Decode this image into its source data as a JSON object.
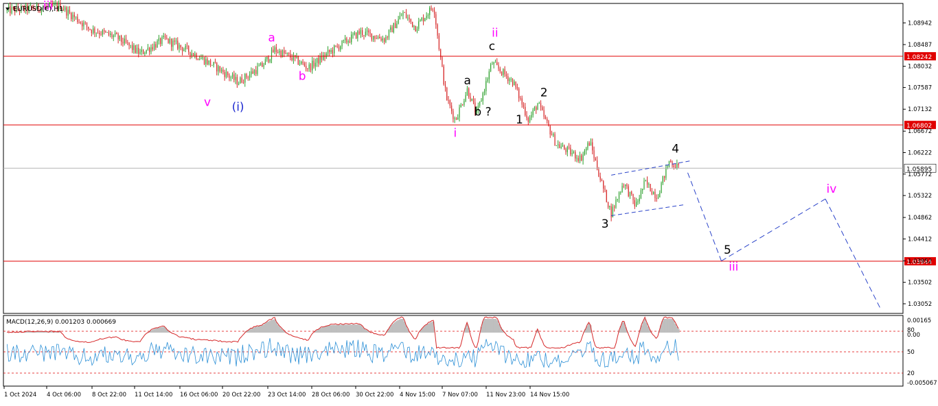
{
  "header": {
    "symbol_label": "EURUSD(€),H1"
  },
  "colors": {
    "bull_candle": "#2ca02c",
    "bear_candle": "#d62728",
    "level_line": "#e00000",
    "current_price": "#b4b4b4",
    "projection": "#2a43c9",
    "label_magenta": "#ff00ff",
    "label_blue": "#1f2bd1",
    "label_black": "#000000",
    "macd_histogram": "#bfbfbf",
    "macd_line": "#d62728",
    "stoch_line": "#2b8fd6"
  },
  "chart_data": {
    "type": "candlestick",
    "symbol": "EURUSD(€)",
    "timeframe": "H1",
    "ylim": [
      1.0285,
      1.0935
    ],
    "y_ticks": [
      "1.08942",
      "1.08487",
      "1.08032",
      "1.07587",
      "1.07132",
      "1.06672",
      "1.06222",
      "1.05772",
      "1.05322",
      "1.04862",
      "1.04412",
      "1.03952",
      "1.03502",
      "1.03052"
    ],
    "x_ticks": [
      "1 Oct 2024",
      "4 Oct 06:00",
      "8 Oct 22:00",
      "11 Oct 14:00",
      "16 Oct 06:00",
      "20 Oct 22:00",
      "23 Oct 14:00",
      "28 Oct 06:00",
      "30 Oct 22:00",
      "4 Nov 15:00",
      "7 Nov 07:00",
      "11 Nov 23:00",
      "14 Nov 15:00"
    ],
    "price_path": [
      {
        "t": 0,
        "price": 1.092
      },
      {
        "t": 0.9,
        "price": 1.093
      },
      {
        "t": 1.0,
        "price": 1.0918
      },
      {
        "t": 1.4,
        "price": 1.088
      },
      {
        "t": 1.8,
        "price": 1.0865
      },
      {
        "t": 2.2,
        "price": 1.083
      },
      {
        "t": 2.6,
        "price": 1.086
      },
      {
        "t": 3.0,
        "price": 1.0835
      },
      {
        "t": 3.4,
        "price": 1.0805
      },
      {
        "t": 3.8,
        "price": 1.077
      },
      {
        "t": 4.2,
        "price": 1.0805
      },
      {
        "t": 4.4,
        "price": 1.0838
      },
      {
        "t": 4.7,
        "price": 1.082
      },
      {
        "t": 4.95,
        "price": 1.08
      },
      {
        "t": 5.3,
        "price": 1.0833
      },
      {
        "t": 5.8,
        "price": 1.0875
      },
      {
        "t": 6.2,
        "price": 1.086
      },
      {
        "t": 6.5,
        "price": 1.0915
      },
      {
        "t": 6.7,
        "price": 1.0885
      },
      {
        "t": 7.0,
        "price": 1.093
      },
      {
        "t": 7.1,
        "price": 1.083
      },
      {
        "t": 7.2,
        "price": 1.074
      },
      {
        "t": 7.35,
        "price": 1.069
      },
      {
        "t": 7.55,
        "price": 1.0755
      },
      {
        "t": 7.7,
        "price": 1.0702
      },
      {
        "t": 7.95,
        "price": 1.081
      },
      {
        "t": 8.3,
        "price": 1.077
      },
      {
        "t": 8.55,
        "price": 1.069
      },
      {
        "t": 8.7,
        "price": 1.0725
      },
      {
        "t": 9.0,
        "price": 1.064
      },
      {
        "t": 9.4,
        "price": 1.061
      },
      {
        "t": 9.55,
        "price": 1.0645
      },
      {
        "t": 9.75,
        "price": 1.0555
      },
      {
        "t": 9.9,
        "price": 1.0495
      },
      {
        "t": 10.1,
        "price": 1.056
      },
      {
        "t": 10.3,
        "price": 1.051
      },
      {
        "t": 10.45,
        "price": 1.056
      },
      {
        "t": 10.65,
        "price": 1.053
      },
      {
        "t": 10.85,
        "price": 1.0605
      },
      {
        "t": 11.0,
        "price": 1.059
      }
    ],
    "horizontal_levels": [
      "1.08242",
      "1.06802",
      "1.03944"
    ],
    "current_price": "1.05895",
    "wave_labels": [
      {
        "text": "iii",
        "t": -1.0,
        "price": 1.0935,
        "color": "magenta"
      },
      {
        "text": "a",
        "t": 4.35,
        "price": 1.0855,
        "color": "magenta"
      },
      {
        "text": "b",
        "t": 4.85,
        "price": 1.0775,
        "color": "magenta"
      },
      {
        "text": "v",
        "t": 3.3,
        "price": 1.072,
        "color": "magenta"
      },
      {
        "text": "(i)",
        "t": 3.8,
        "price": 1.071,
        "color": "blue"
      },
      {
        "text": "ii",
        "t": 8.0,
        "price": 1.0865,
        "color": "magenta"
      },
      {
        "text": "c",
        "t": 7.95,
        "price": 1.0837,
        "color": "black"
      },
      {
        "text": "a",
        "t": 7.55,
        "price": 1.0765,
        "color": "black"
      },
      {
        "text": "b ?",
        "t": 7.8,
        "price": 1.07,
        "color": "black"
      },
      {
        "text": "1",
        "t": 8.4,
        "price": 1.0683,
        "color": "black"
      },
      {
        "text": "2",
        "t": 8.8,
        "price": 1.074,
        "color": "black"
      },
      {
        "text": "i",
        "t": 7.35,
        "price": 1.0655,
        "color": "magenta"
      },
      {
        "text": "3",
        "t": 9.8,
        "price": 1.0465,
        "color": "black"
      },
      {
        "text": "4",
        "t": 10.95,
        "price": 1.0622,
        "color": "black"
      },
      {
        "text": "5",
        "t": 11.8,
        "price": 1.041,
        "color": "black"
      },
      {
        "text": "iii",
        "t": 11.9,
        "price": 1.0375,
        "color": "magenta"
      },
      {
        "text": "iv",
        "t": 13.5,
        "price": 1.0538,
        "color": "magenta"
      }
    ],
    "triangle_channel": [
      [
        {
          "t": 9.9,
          "price": 1.0575
        },
        {
          "t": 11.2,
          "price": 1.0605
        }
      ],
      [
        {
          "t": 9.9,
          "price": 1.049
        },
        {
          "t": 11.1,
          "price": 1.0513
        }
      ]
    ],
    "projection_path": [
      {
        "t": 11.15,
        "price": 1.058
      },
      {
        "t": 11.7,
        "price": 1.0395
      },
      {
        "t": 13.4,
        "price": 1.0525
      },
      {
        "t": 14.3,
        "price": 1.0295
      }
    ],
    "macd": {
      "label": "MACD(12,26,9) 0.001203 0.000669",
      "y_ticks": [
        "0.00165",
        "80",
        "0.00",
        "50",
        "20",
        "-0.005067"
      ]
    },
    "grid": false
  }
}
